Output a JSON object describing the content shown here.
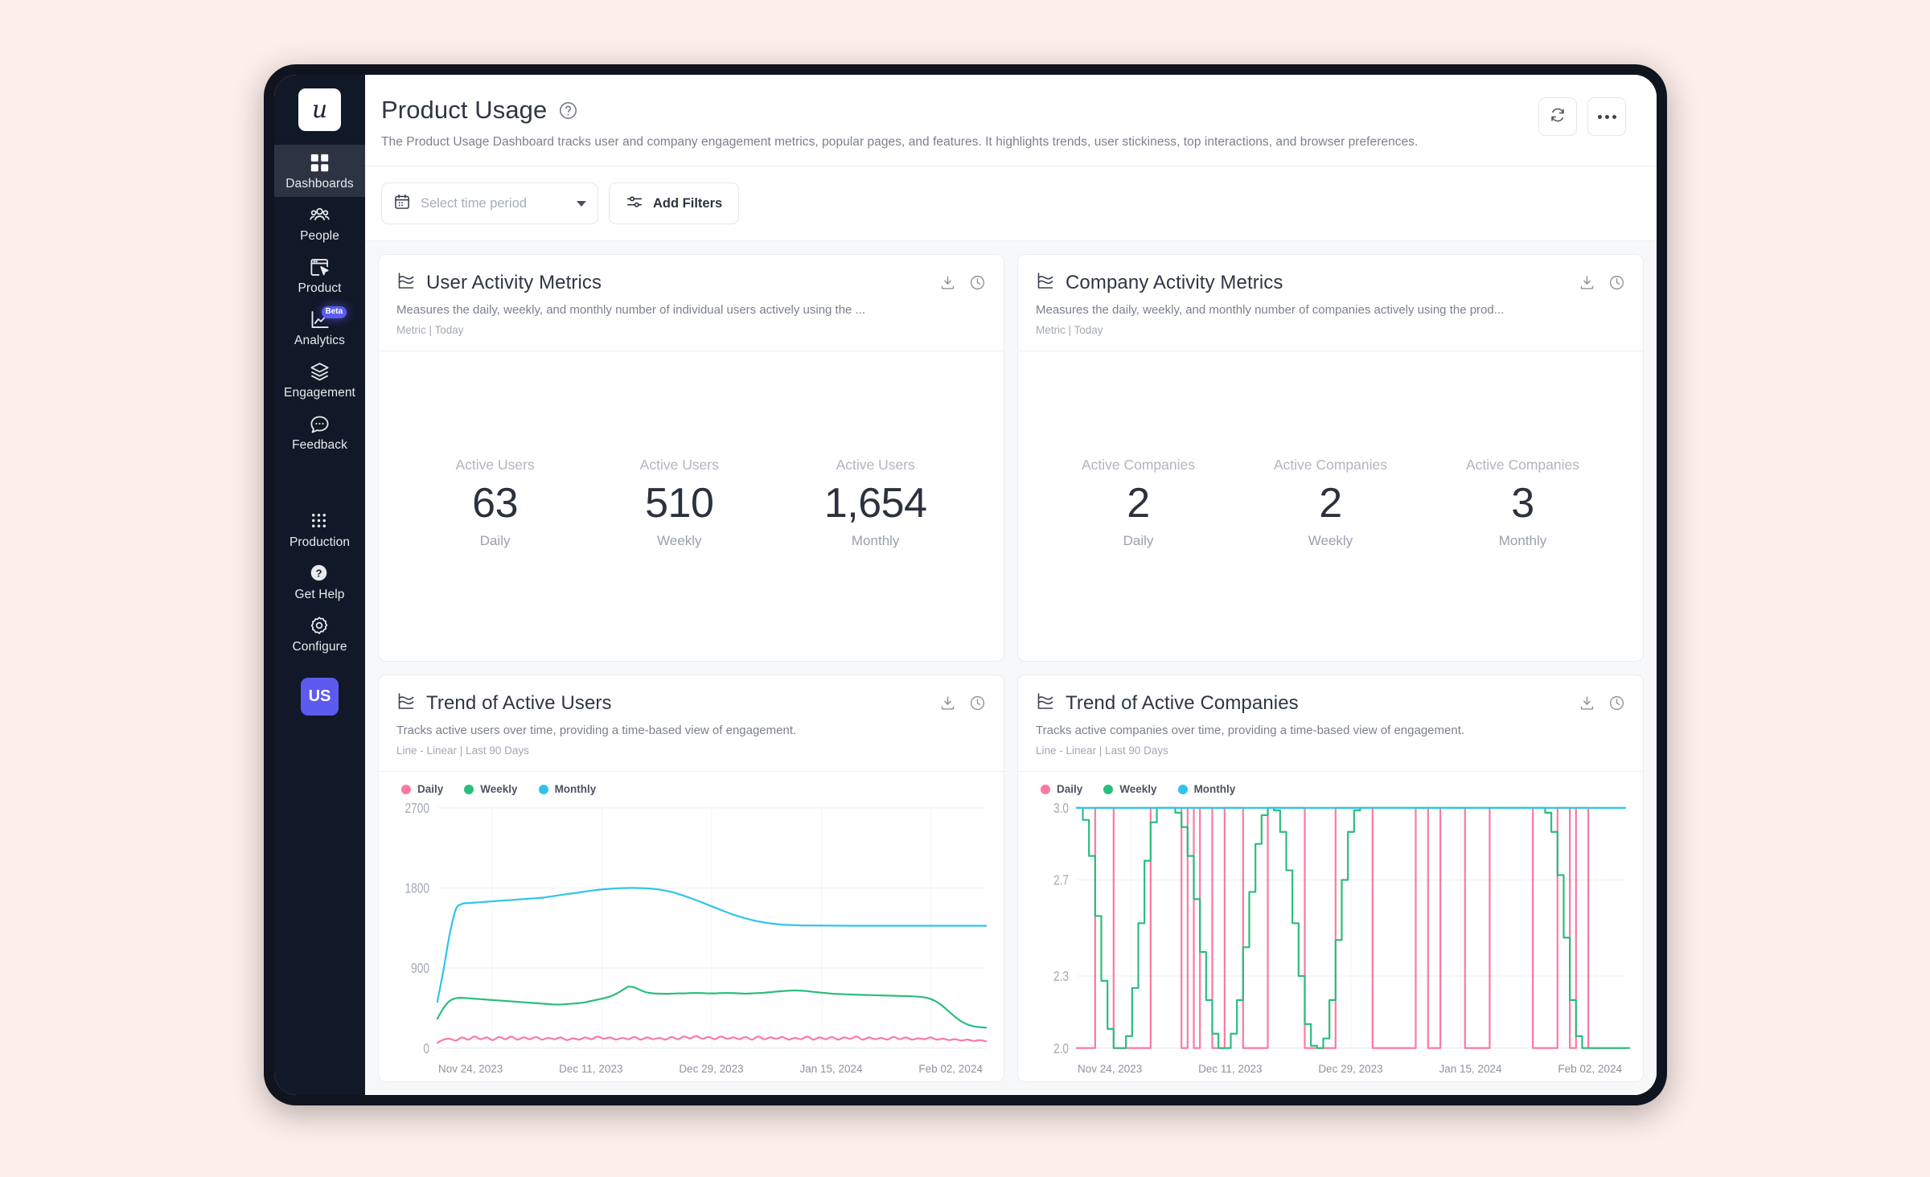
{
  "sidebar": {
    "logo_text": "u",
    "items": [
      {
        "label": "Dashboards",
        "icon": "grid-squares-icon",
        "active": true
      },
      {
        "label": "People",
        "icon": "people-icon",
        "active": false
      },
      {
        "label": "Product",
        "icon": "product-cursor-icon",
        "active": false
      },
      {
        "label": "Analytics",
        "icon": "analytics-chart-icon",
        "active": false,
        "badge": "Beta"
      },
      {
        "label": "Engagement",
        "icon": "layers-icon",
        "active": false
      },
      {
        "label": "Feedback",
        "icon": "chat-bubble-icon",
        "active": false
      }
    ],
    "bottom_items": [
      {
        "label": "Production",
        "icon": "dot-grid-icon"
      },
      {
        "label": "Get Help",
        "icon": "question-circle-icon"
      },
      {
        "label": "Configure",
        "icon": "gear-icon"
      }
    ],
    "avatar_initials": "US",
    "avatar_color": "#5b5bf0",
    "badge_color": "#5b5bf0"
  },
  "header": {
    "title": "Product Usage",
    "help_icon": "question-circle-icon",
    "subtitle": "The Product Usage Dashboard tracks user and company engagement metrics, popular pages, and features. It highlights trends, user stickiness, top interactions, and browser preferences.",
    "refresh_icon": "refresh-icon",
    "more_icon": "ellipsis-icon"
  },
  "toolbar": {
    "time_period_placeholder": "Select time period",
    "calendar_icon": "calendar-icon",
    "add_filters_label": "Add Filters",
    "filters_icon": "sliders-icon"
  },
  "cards": {
    "user_activity": {
      "title": "User Activity Metrics",
      "icon": "line-chart-icon",
      "description": "Measures the daily, weekly, and monthly number of individual users actively using the ...",
      "meta": "Metric | Today",
      "download_icon": "download-icon",
      "clock_icon": "clock-icon",
      "metrics": [
        {
          "name": "Active Users",
          "value": "63",
          "period": "Daily"
        },
        {
          "name": "Active Users",
          "value": "510",
          "period": "Weekly"
        },
        {
          "name": "Active Users",
          "value": "1,654",
          "period": "Monthly"
        }
      ]
    },
    "company_activity": {
      "title": "Company Activity Metrics",
      "icon": "line-chart-icon",
      "description": "Measures the daily, weekly, and monthly number of companies actively using the prod...",
      "meta": "Metric | Today",
      "download_icon": "download-icon",
      "clock_icon": "clock-icon",
      "metrics": [
        {
          "name": "Active Companies",
          "value": "2",
          "period": "Daily"
        },
        {
          "name": "Active Companies",
          "value": "2",
          "period": "Weekly"
        },
        {
          "name": "Active Companies",
          "value": "3",
          "period": "Monthly"
        }
      ]
    },
    "trend_users": {
      "title": "Trend of Active Users",
      "icon": "line-chart-icon",
      "description": "Tracks active users over time, providing a time-based view of engagement.",
      "meta": "Line - Linear | Last 90 Days",
      "download_icon": "download-icon",
      "clock_icon": "clock-icon"
    },
    "trend_companies": {
      "title": "Trend of Active Companies",
      "icon": "line-chart-icon",
      "description": "Tracks active companies over time, providing a time-based view of engagement.",
      "meta": "Line - Linear | Last 90 Days",
      "download_icon": "download-icon",
      "clock_icon": "clock-icon"
    }
  },
  "chart_data": [
    {
      "id": "trend_users",
      "type": "line",
      "title": "Trend of Active Users",
      "xlabel": "",
      "ylabel": "",
      "grid": true,
      "legend_position": "top-left",
      "yticks": [
        0,
        900,
        1800,
        2700
      ],
      "ylim": [
        0,
        2700
      ],
      "xticks": [
        "Nov 24, 2023",
        "Dec 11, 2023",
        "Dec 29, 2023",
        "Jan 15, 2024",
        "Feb 02, 2024"
      ],
      "colors": {
        "Daily": "#fb7aa0",
        "Weekly": "#2bbd7e",
        "Monthly": "#2ec5ea"
      },
      "series": [
        {
          "name": "Daily",
          "color": "#fb7aa0",
          "values": [
            60,
            95,
            105,
            85,
            120,
            95,
            130,
            100,
            120,
            90,
            125,
            100,
            130,
            95,
            120,
            100,
            125,
            95,
            115,
            100,
            120,
            90,
            110,
            95,
            120,
            100,
            130,
            105,
            120,
            95,
            115,
            100,
            125,
            95,
            120,
            100,
            115,
            95,
            125,
            100,
            130,
            110,
            135,
            105,
            125,
            100,
            130,
            105,
            120,
            100,
            125,
            95,
            130,
            100,
            120,
            105,
            125,
            95,
            115,
            100,
            130,
            95,
            120,
            100,
            125,
            95,
            120,
            105,
            130,
            95,
            120,
            100,
            115,
            95,
            125,
            100,
            120,
            95,
            110,
            100,
            120,
            95,
            105,
            90,
            100,
            85,
            95,
            80,
            90,
            75
          ]
        },
        {
          "name": "Weekly",
          "color": "#2bbd7e",
          "values": [
            330,
            450,
            530,
            560,
            565,
            560,
            555,
            550,
            545,
            540,
            535,
            530,
            525,
            520,
            515,
            510,
            505,
            500,
            495,
            490,
            490,
            495,
            500,
            505,
            515,
            530,
            545,
            560,
            580,
            610,
            650,
            690,
            680,
            650,
            625,
            615,
            612,
            610,
            612,
            615,
            615,
            618,
            620,
            618,
            615,
            615,
            618,
            620,
            618,
            615,
            612,
            615,
            618,
            622,
            628,
            635,
            640,
            645,
            648,
            645,
            640,
            632,
            625,
            618,
            612,
            608,
            605,
            602,
            600,
            598,
            596,
            594,
            592,
            590,
            588,
            586,
            584,
            582,
            578,
            570,
            552,
            520,
            470,
            410,
            350,
            300,
            265,
            245,
            235,
            230
          ]
        },
        {
          "name": "Monthly",
          "color": "#2ec5ea",
          "values": [
            520,
            880,
            1280,
            1560,
            1620,
            1630,
            1635,
            1640,
            1645,
            1650,
            1655,
            1660,
            1665,
            1670,
            1675,
            1680,
            1685,
            1690,
            1700,
            1710,
            1720,
            1730,
            1740,
            1750,
            1760,
            1770,
            1778,
            1785,
            1790,
            1795,
            1798,
            1800,
            1800,
            1798,
            1795,
            1790,
            1782,
            1770,
            1755,
            1735,
            1712,
            1688,
            1662,
            1635,
            1608,
            1580,
            1552,
            1525,
            1500,
            1478,
            1458,
            1440,
            1425,
            1412,
            1402,
            1394,
            1388,
            1384,
            1381,
            1379,
            1378,
            1378,
            1377,
            1377,
            1376,
            1376,
            1376,
            1375,
            1375,
            1375,
            1375,
            1375,
            1375,
            1375,
            1375,
            1375,
            1375,
            1375,
            1375,
            1375,
            1375,
            1375,
            1375,
            1375,
            1375,
            1375,
            1375,
            1375,
            1375,
            1375
          ]
        }
      ]
    },
    {
      "id": "trend_companies",
      "type": "line",
      "title": "Trend of Active Companies",
      "xlabel": "",
      "ylabel": "",
      "grid": true,
      "legend_position": "top-left",
      "yticks": [
        2.0,
        2.3,
        2.7,
        3.0
      ],
      "ylim": [
        2.0,
        3.0
      ],
      "xticks": [
        "Nov 24, 2023",
        "Dec 11, 2023",
        "Dec 29, 2023",
        "Jan 15, 2024",
        "Feb 02, 2024"
      ],
      "colors": {
        "Daily": "#fb7aa0",
        "Weekly": "#2bbd7e",
        "Monthly": "#2ec5ea"
      },
      "series": [
        {
          "name": "Daily",
          "color": "#fb7aa0",
          "values": [
            2,
            2,
            2,
            3,
            3,
            3,
            2,
            2,
            2,
            2,
            2,
            2,
            3,
            3,
            3,
            3,
            3,
            2,
            3,
            2,
            3,
            3,
            2,
            2,
            3,
            3,
            3,
            2,
            2,
            2,
            2,
            3,
            3,
            3,
            3,
            3,
            3,
            2,
            2,
            2,
            2,
            2,
            3,
            3,
            3,
            3,
            3,
            3,
            2,
            2,
            2,
            2,
            2,
            2,
            2,
            3,
            3,
            2,
            2,
            3,
            3,
            3,
            3,
            2,
            2,
            2,
            2,
            3,
            3,
            3,
            3,
            3,
            3,
            3,
            2,
            2,
            2,
            2,
            3,
            3,
            2,
            3,
            3,
            2,
            2,
            2,
            2,
            2,
            2,
            2
          ]
        },
        {
          "name": "Weekly",
          "color": "#2bbd7e",
          "values": [
            3,
            2.95,
            2.8,
            2.55,
            2.28,
            2.08,
            2,
            2,
            2.05,
            2.25,
            2.52,
            2.78,
            2.94,
            3,
            3,
            3,
            2.98,
            2.92,
            2.8,
            2.62,
            2.4,
            2.2,
            2.06,
            2,
            2,
            2.06,
            2.2,
            2.42,
            2.65,
            2.85,
            2.97,
            3,
            2.99,
            2.9,
            2.74,
            2.52,
            2.3,
            2.1,
            2.01,
            2,
            2.04,
            2.2,
            2.45,
            2.7,
            2.9,
            2.99,
            3,
            3,
            3,
            3,
            3,
            3,
            3,
            3,
            3,
            3,
            3,
            3,
            3,
            3,
            3,
            3,
            3,
            3,
            3,
            3,
            3,
            3,
            3,
            3,
            3,
            3,
            3,
            3,
            3,
            3,
            2.98,
            2.9,
            2.72,
            2.46,
            2.2,
            2.05,
            2,
            2,
            2,
            2,
            2,
            2,
            2,
            2,
            2
          ]
        },
        {
          "name": "Monthly",
          "color": "#2ec5ea",
          "values": [
            3,
            3,
            3,
            3,
            3,
            3,
            3,
            3,
            3,
            3,
            3,
            3,
            3,
            3,
            3,
            3,
            3,
            3,
            3,
            3,
            3,
            3,
            3,
            3,
            3,
            3,
            3,
            3,
            3,
            3,
            3,
            3,
            3,
            3,
            3,
            3,
            3,
            3,
            3,
            3,
            3,
            3,
            3,
            3,
            3,
            3,
            3,
            3,
            3,
            3,
            3,
            3,
            3,
            3,
            3,
            3,
            3,
            3,
            3,
            3,
            3,
            3,
            3,
            3,
            3,
            3,
            3,
            3,
            3,
            3,
            3,
            3,
            3,
            3,
            3,
            3,
            3,
            3,
            3,
            3,
            3,
            3,
            3,
            3,
            3,
            3,
            3,
            3,
            3,
            3
          ]
        }
      ]
    }
  ]
}
